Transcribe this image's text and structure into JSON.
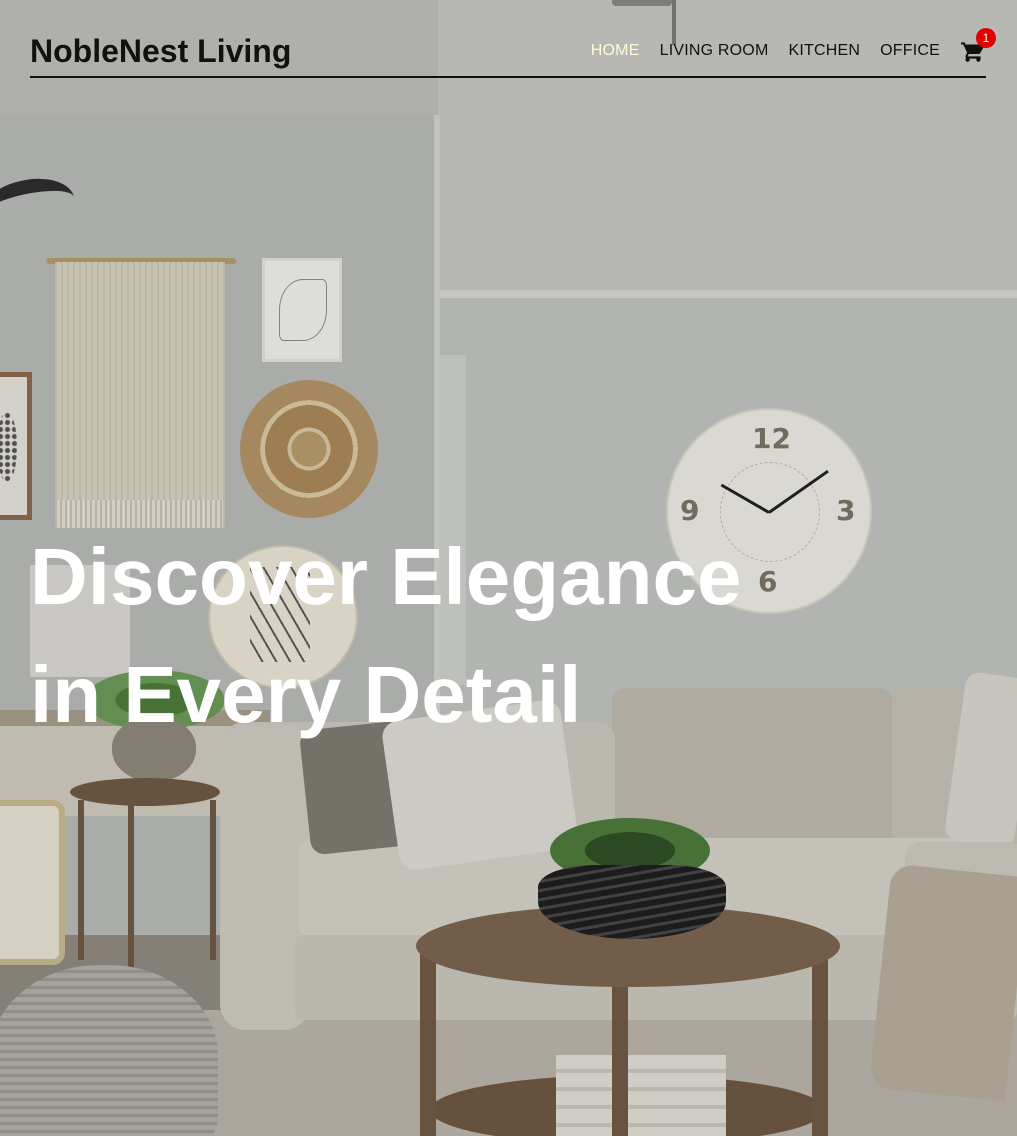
{
  "brand": {
    "name": "NobleNest Living"
  },
  "nav": {
    "items": [
      {
        "label": "HOME",
        "active": true
      },
      {
        "label": "LIVING ROOM",
        "active": false
      },
      {
        "label": "KITCHEN",
        "active": false
      },
      {
        "label": "OFFICE",
        "active": false
      }
    ],
    "active_color": "#fffbd6"
  },
  "cart": {
    "icon": "shopping-cart-icon",
    "count": "1",
    "badge_color": "#e00000"
  },
  "hero": {
    "headline_line1": "Discover Elegance",
    "headline_line2": "in Every Detail",
    "background": "living-room-photo"
  }
}
